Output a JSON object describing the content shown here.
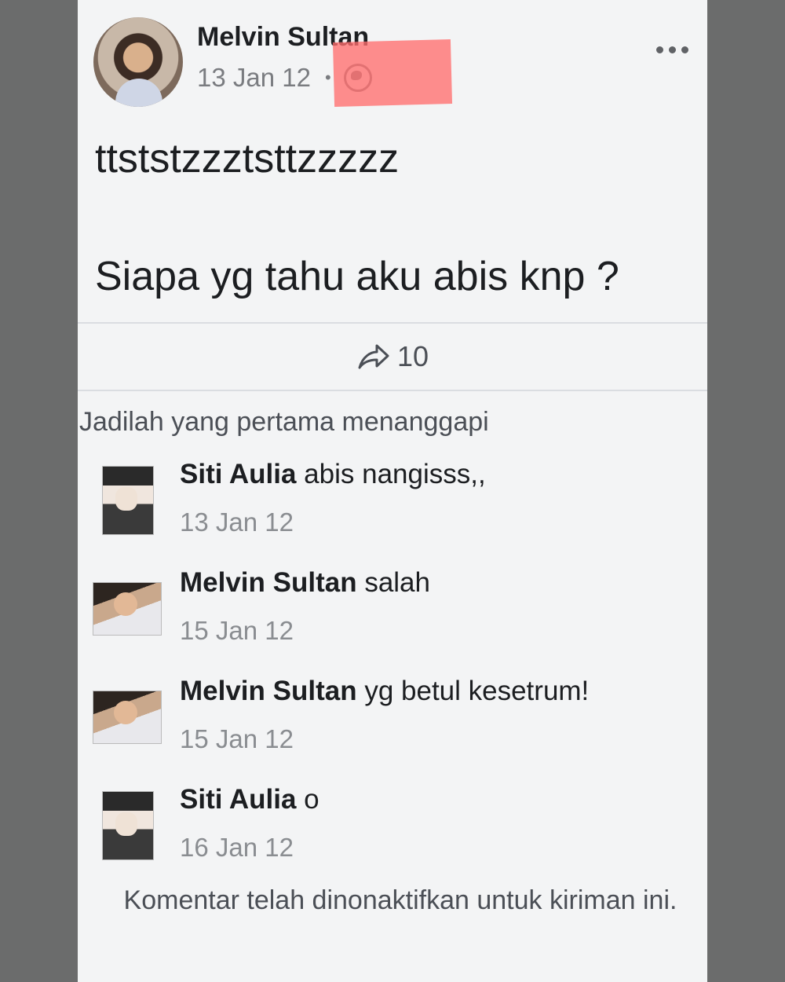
{
  "post": {
    "author": "Melvin Sultan",
    "date": "13 Jan 12",
    "privacy_icon": "globe-icon",
    "line1": "ttststzzztsttzzzzz",
    "line2": "Siapa yg tahu aku abis knp ?",
    "share_count": "10"
  },
  "comments_header": "Jadilah yang pertama menanggapi",
  "comments": [
    {
      "name": "Siti Aulia",
      "text": " abis nangisss,,",
      "date": "13 Jan 12"
    },
    {
      "name": "Melvin Sultan",
      "text": " salah",
      "date": "15 Jan 12"
    },
    {
      "name": "Melvin Sultan",
      "text": " yg betul kesetrum!",
      "date": "15 Jan 12"
    },
    {
      "name": "Siti Aulia",
      "text": " o",
      "date": "16 Jan 12"
    }
  ],
  "disabled_note": "Komentar telah dinonaktifkan untuk kiriman ini.",
  "colors": {
    "redaction": "#ff6e6e",
    "background": "#6b6c6c",
    "card": "#f3f4f5"
  }
}
